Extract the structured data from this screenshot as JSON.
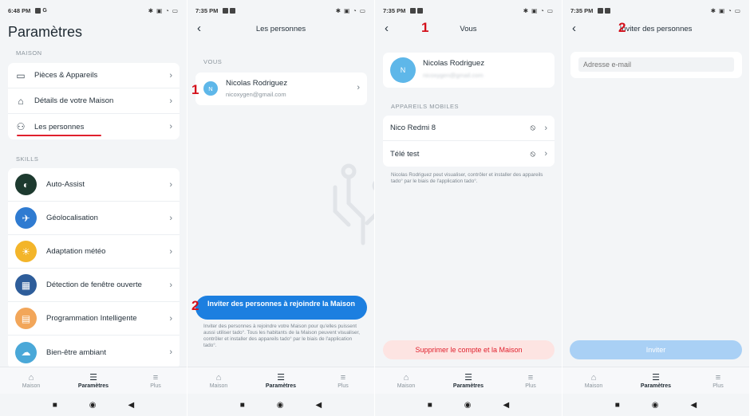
{
  "screen1": {
    "status_time": "6:48 PM",
    "title": "Paramètres",
    "maison_header": "MAISON",
    "maison_items": [
      {
        "label": "Pièces & Appareils",
        "icon": "devices-icon"
      },
      {
        "label": "Détails de votre Maison",
        "icon": "home-icon"
      },
      {
        "label": "Les personnes",
        "icon": "people-icon"
      }
    ],
    "skills_header": "SKILLS",
    "skills": [
      {
        "label": "Auto-Assist",
        "color": "#1d3a2f"
      },
      {
        "label": "Géolocalisation",
        "color": "#2f7bd1"
      },
      {
        "label": "Adaptation météo",
        "color": "#f3b52a"
      },
      {
        "label": "Détection de fenêtre ouverte",
        "color": "#2e5d9a"
      },
      {
        "label": "Programmation Intelligente",
        "color": "#f2a65a"
      },
      {
        "label": "Bien-être ambiant",
        "color": "#4aa8d8"
      }
    ]
  },
  "screen2": {
    "status_time": "7:35 PM",
    "title": "Les personnes",
    "section": "VOUS",
    "avatar_initial": "N",
    "name": "Nicolas Rodriguez",
    "email": "nicoxygen@gmail.com",
    "note_1": "1",
    "note_2": "2",
    "invite_button": "Inviter des personnes à rejoindre la Maison",
    "invite_text": "Inviter des personnes à rejoindre votre Maison pour qu'elles puissent aussi utiliser tado°. Tous les habitants de la Maison peuvent visualiser, contrôler et installer des appareils tado° par le biais de l'application tado°."
  },
  "screen3": {
    "status_time": "7:35 PM",
    "title": "Vous",
    "note": "1",
    "avatar_initial": "N",
    "name": "Nicolas Rodriguez",
    "email_blurred": "nicoxygen@gmail.com",
    "section": "APPAREILS MOBILES",
    "devices": [
      {
        "label": "Nico Redmi 8"
      },
      {
        "label": "Télé test"
      }
    ],
    "devices_text": "Nicolas Rodriguez peut visualiser, contrôler et installer des appareils tado° par le biais de l'application tado°.",
    "delete_button": "Supprimer le compte et la Maison"
  },
  "screen4": {
    "status_time": "7:35 PM",
    "title": "Inviter des personnes",
    "note": "2",
    "email_placeholder": "Adresse e-mail",
    "invite_button": "Inviter"
  },
  "nav": {
    "home": "Maison",
    "settings": "Paramètres",
    "more": "Plus"
  },
  "colors": {
    "accent": "#1c7fe0",
    "danger": "#e0202d",
    "annotation": "#d4101b"
  }
}
